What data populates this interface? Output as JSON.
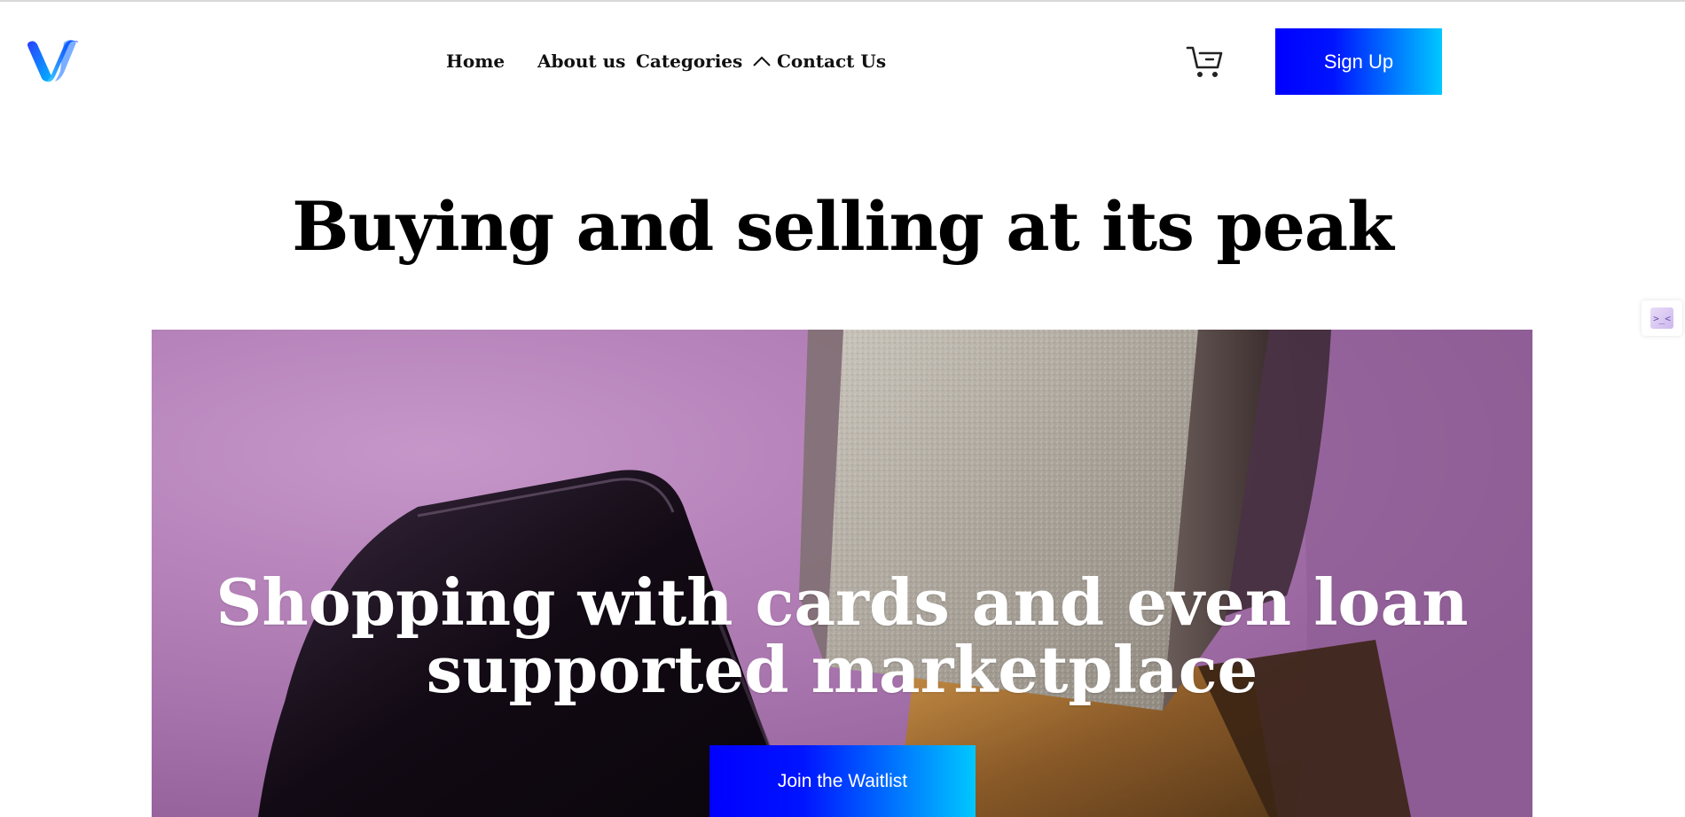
{
  "brand": {
    "logo_icon": "v-logo-icon",
    "accent_gradient": [
      "#0000ff",
      "#00c8ff"
    ]
  },
  "nav": {
    "items": [
      {
        "label": "Home"
      },
      {
        "label": "About us"
      },
      {
        "label": "Categories",
        "icon": "chevron-up-icon"
      },
      {
        "label": "Contact Us"
      }
    ]
  },
  "header": {
    "cart_icon": "cart-icon",
    "signup_label": "Sign Up"
  },
  "hero": {
    "title": "Buying and selling at its peak"
  },
  "banner": {
    "headline": "Shopping with cards and even loan supported marketplace",
    "cta_label": "Join the Waitlist",
    "background_color": "#b07ab5"
  },
  "side_widget": {
    "icon": "extension-icon",
    "glyph": ">_<"
  }
}
